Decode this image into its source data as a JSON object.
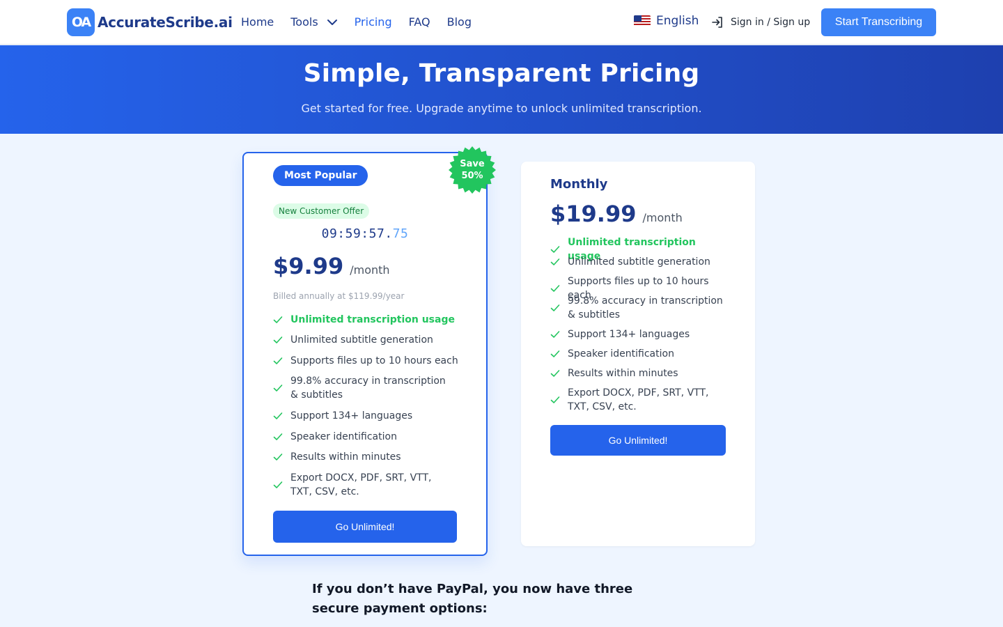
{
  "header": {
    "logo_mark": "OA",
    "logo_text": "AccurateScribe.ai",
    "nav": {
      "home": "Home",
      "tools": "Tools",
      "pricing": "Pricing",
      "faq": "FAQ",
      "blog": "Blog"
    },
    "language": "English",
    "signin": "Sign in / Sign up",
    "cta": "Start Transcribing"
  },
  "hero": {
    "title": "Simple, Transparent Pricing",
    "subtitle": "Get started for free. Upgrade anytime to unlock unlimited transcription."
  },
  "annual": {
    "badge": "Most Popular",
    "save_line1": "Save",
    "save_line2": "50%",
    "offer": "New Customer Offer",
    "timer_main": "09:59:57.",
    "timer_ms": "75",
    "price": "$9.99",
    "per": "/month",
    "billed": "Billed annually at $119.99/year",
    "features": [
      "Unlimited transcription usage",
      "Unlimited subtitle generation",
      "Supports files up to 10 hours each",
      "99.8% accuracy in transcription & subtitles",
      "Support 134+ languages",
      "Speaker identification",
      "Results within minutes",
      "Export DOCX, PDF, SRT, VTT, TXT, CSV, etc."
    ],
    "button": "Go Unlimited!"
  },
  "monthly": {
    "title": "Monthly",
    "price": "$19.99",
    "per": "/month",
    "features": [
      "Unlimited transcription usage",
      "Unlimited subtitle generation",
      "Supports files up to 10 hours each",
      "99.8% accuracy in transcription & subtitles",
      "Support 134+ languages",
      "Speaker identification",
      "Results within minutes",
      "Export DOCX, PDF, SRT, VTT, TXT, CSV, etc."
    ],
    "button": "Go Unlimited!"
  },
  "payment_note": "If you don’t have PayPal, you now have three secure payment options:",
  "colors": {
    "primary": "#2563eb",
    "brand_dark": "#1e3a8a",
    "success": "#22c55e",
    "background": "#eef5ff"
  }
}
